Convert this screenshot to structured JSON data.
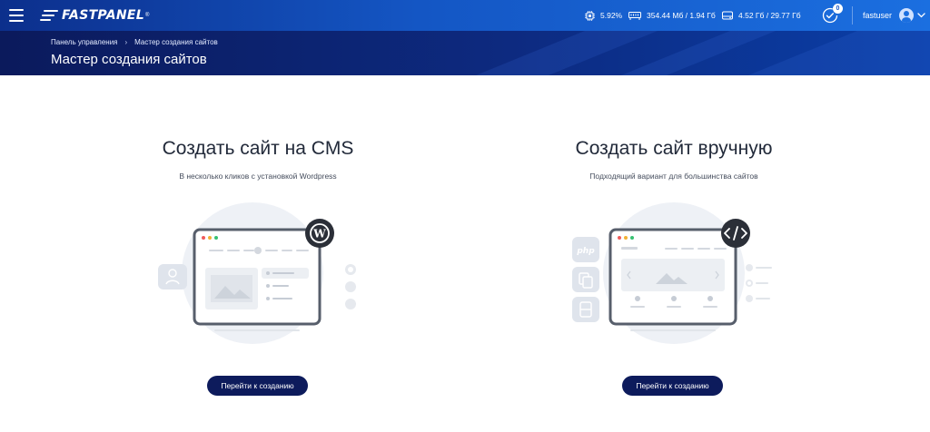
{
  "topbar": {
    "logo_text": "FASTPANEL",
    "logo_mark": "®",
    "cpu": "5.92%",
    "ram": "354.44 Мб / 1.94 Гб",
    "disk": "4.52 Гб / 29.77 Гб",
    "tasks_count": "0",
    "username": "fastuser",
    "icons": [
      "menu-icon",
      "cpu-icon",
      "ram-icon",
      "disk-icon",
      "tasks-icon",
      "user-icon",
      "chevron-down-icon"
    ]
  },
  "breadcrumb": {
    "home": "Панель управления",
    "separator": "›",
    "current": "Мастер создания сайтов"
  },
  "page_title": "Мастер создания сайтов",
  "cards": {
    "cms": {
      "title": "Создать сайт на CMS",
      "subtitle": "В несколько кликов с установкой Wordpress",
      "button": "Перейти к созданию",
      "badge_icon": "wordpress-icon"
    },
    "manual": {
      "title": "Создать сайт вручную",
      "subtitle": "Подходящий вариант для большинства сайтов",
      "button": "Перейти к созданию",
      "badge_icon": "code-icon",
      "side_label": "php"
    }
  },
  "colors": {
    "topbar_start": "#0c2f8c",
    "topbar_end": "#1b6fe0",
    "header_bg": "#0b1a5c",
    "button_bg": "#0d1b5c",
    "title_text": "#222a3a"
  }
}
